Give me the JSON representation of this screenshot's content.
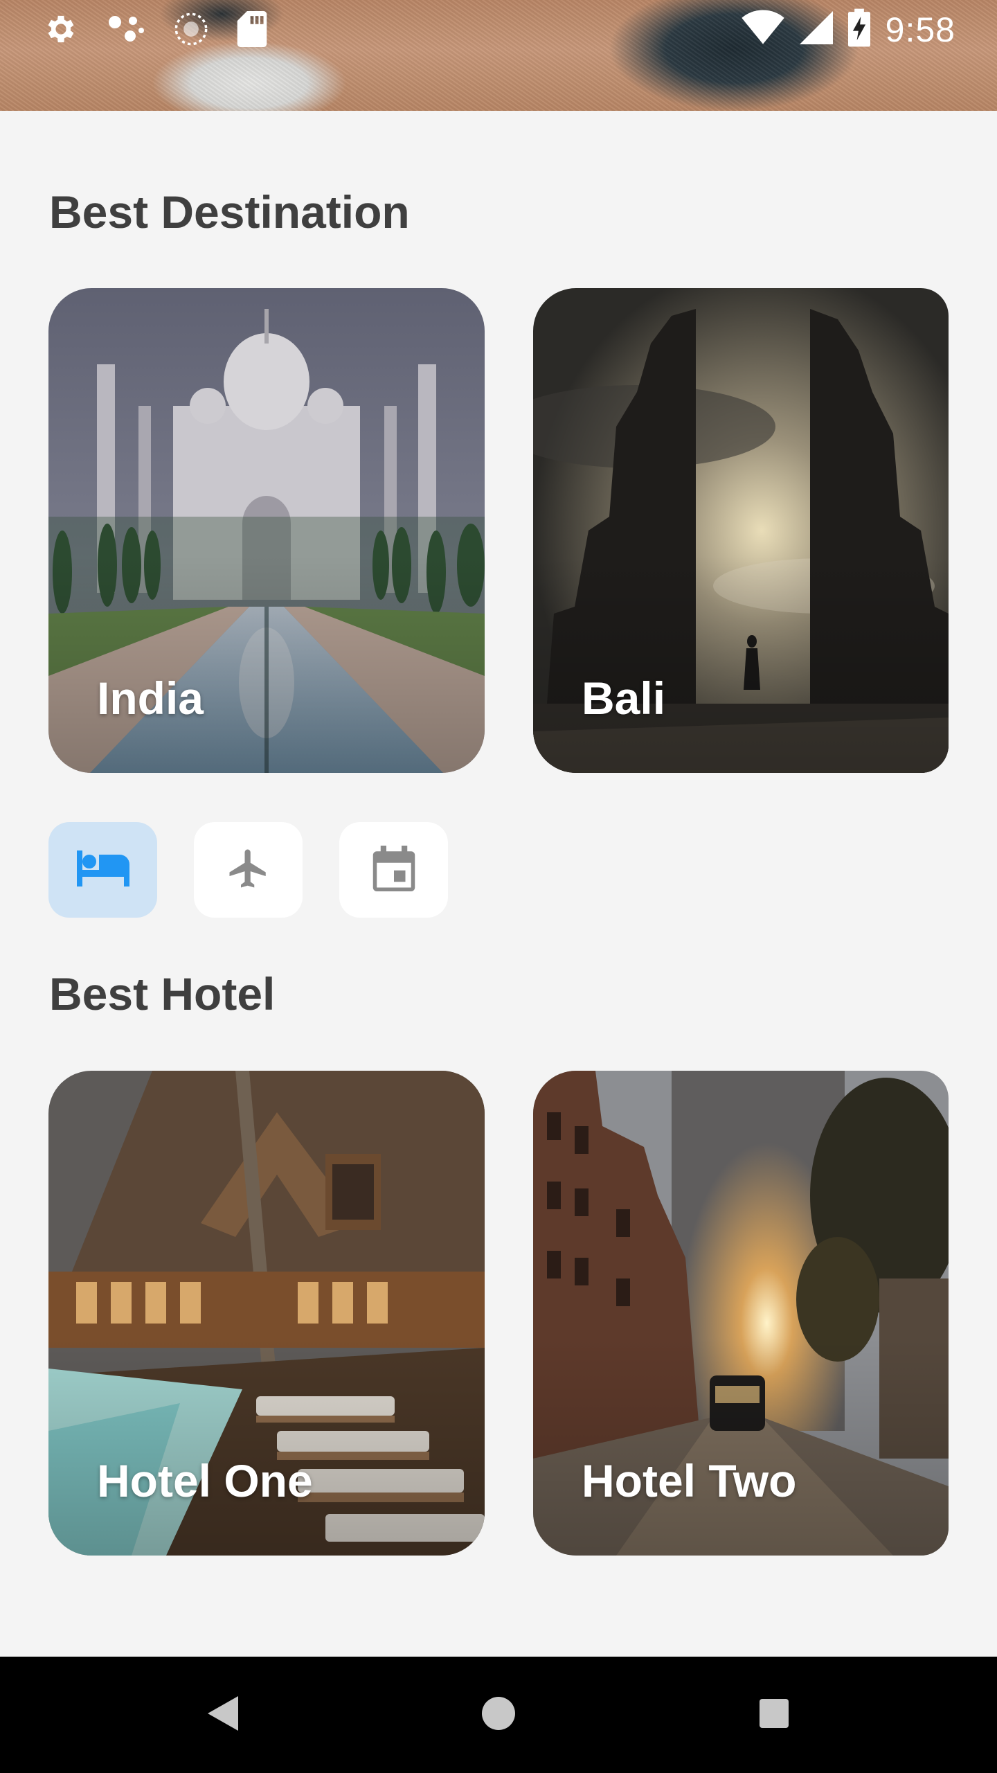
{
  "status_bar": {
    "time": "9:58",
    "left_icons": [
      "settings-icon",
      "assistant-dots-icon",
      "sync-icon",
      "sd-card-icon"
    ],
    "right_icons": [
      "wifi-icon",
      "cell-signal-icon",
      "battery-charging-icon"
    ]
  },
  "sections": {
    "destination": {
      "title": "Best Destination",
      "cards": [
        {
          "label": "India",
          "image": "taj-mahal-photo"
        },
        {
          "label": "Bali",
          "image": "bali-gate-photo"
        }
      ]
    },
    "hotel": {
      "title": "Best Hotel",
      "cards": [
        {
          "label": "Hotel One",
          "image": "resort-pool-photo"
        },
        {
          "label": "Hotel Two",
          "image": "city-street-photo"
        }
      ]
    }
  },
  "categories": [
    {
      "icon": "bed-icon",
      "active": true
    },
    {
      "icon": "airplane-icon",
      "active": false
    },
    {
      "icon": "calendar-icon",
      "active": false
    }
  ],
  "colors": {
    "accent": "#2196f3",
    "active_tab_bg": "#cfe3f5",
    "inactive_icon": "#8a8a8a",
    "page_bg": "#f4f4f4",
    "title_text": "#3f3f3f"
  },
  "nav_bar": [
    "back-icon",
    "home-icon",
    "recents-icon"
  ]
}
